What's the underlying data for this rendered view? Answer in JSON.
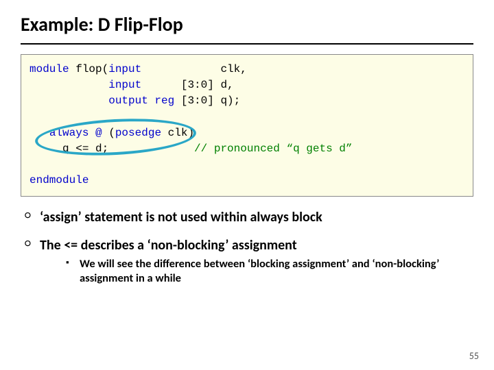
{
  "title": "Example: D Flip-Flop",
  "code": {
    "l1a": "module",
    "l1b": " flop(",
    "l1c": "input",
    "l1d": "            clk,",
    "l2a": "            ",
    "l2b": "input",
    "l2c": "      [3:0] d,",
    "l3a": "            ",
    "l3b": "output reg",
    "l3c": " [3:0] q);",
    "blank1": " ",
    "l4a": "   ",
    "l4b": "always @",
    "l4c": " (",
    "l4d": "posedge",
    "l4e": " clk)",
    "l5a": "     q <= d;             ",
    "l5b": "// pronounced “q gets d”",
    "blank2": " ",
    "l6a": "endmodule"
  },
  "bullets": {
    "b1": "‘assign’ statement is not used within always block",
    "b2": "The <= describes a ‘non-blocking’ assignment",
    "b2a": "We will see the difference between ‘blocking assignment’ and ‘non-blocking’ assignment in a while"
  },
  "pagenum": "55"
}
